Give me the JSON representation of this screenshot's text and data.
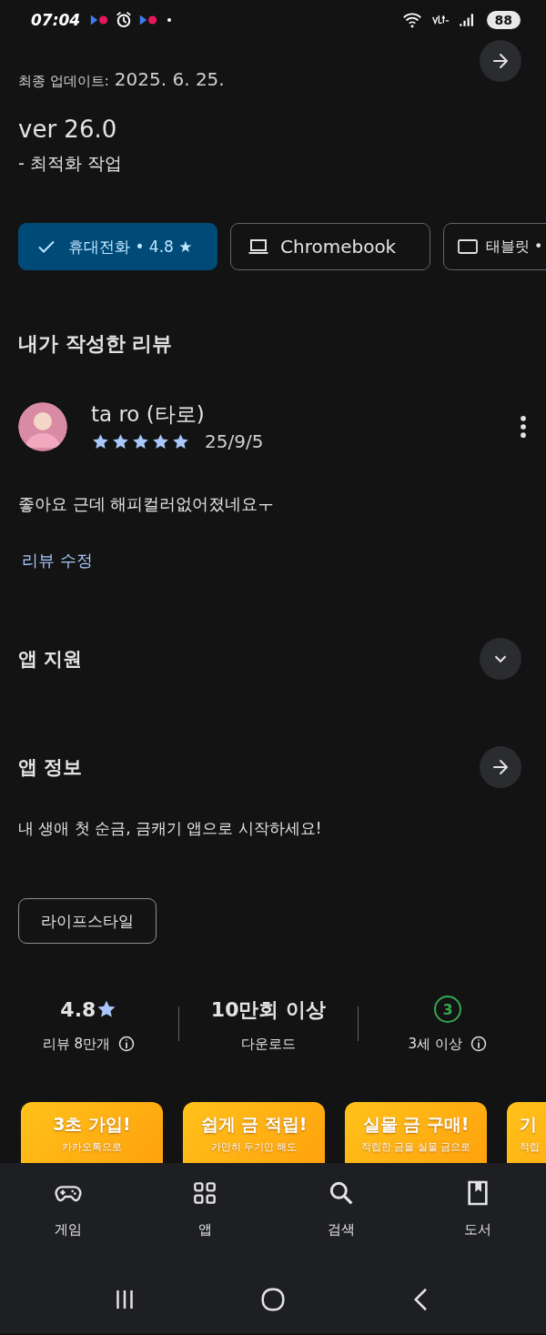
{
  "status_bar": {
    "time": "07:04",
    "battery": "88"
  },
  "update": {
    "last_updated_label": "최종 업데이트:",
    "last_updated": "2025. 6. 25.",
    "version": "ver 26.0",
    "notes": "- 최적화 작업"
  },
  "devices": [
    {
      "kind": "phone",
      "label": "휴대전화 • 4.8 ★",
      "selected": true
    },
    {
      "kind": "laptop",
      "label": "Chromebook",
      "selected": false
    },
    {
      "kind": "tablet",
      "label": "태블릿 •",
      "selected": false
    }
  ],
  "my_review": {
    "heading": "내가 작성한 리뷰",
    "author": "ta ro (타로)",
    "stars": 5,
    "date": "25/9/5",
    "text": "좋아요 근데 해피컬러없어졌네요ㅜ",
    "edit_link": "리뷰 수정"
  },
  "sections": [
    {
      "kind": "expand",
      "title": "앱 지원",
      "expanded": false
    },
    {
      "kind": "link",
      "title": "앱 정보"
    }
  ],
  "description": "내 생애 첫 순금, 금캐기 앱으로 시작하세요!",
  "tags": [
    "라이프스타일"
  ],
  "stats": [
    {
      "kind": "rating",
      "value": "4.8",
      "label": "리뷰 8만개"
    },
    {
      "kind": "plain",
      "value": "10만회 이상",
      "label": "다운로드"
    },
    {
      "kind": "age",
      "value": "3",
      "label": "3세 이상"
    }
  ],
  "screenshots": [
    {
      "title": "3초 가입!",
      "subtitle": "카카오톡으로"
    },
    {
      "title": "쉽게 금 적립!",
      "subtitle": "가만히 두기만 해도"
    },
    {
      "title": "실물 금 구매!",
      "subtitle": "적립한 금을 실물 금으로"
    },
    {
      "title": "기",
      "subtitle": "적립"
    }
  ],
  "bottom_nav": [
    {
      "kind": "games",
      "label": "게임",
      "selected": false
    },
    {
      "kind": "apps",
      "label": "앱",
      "selected": false
    },
    {
      "kind": "search",
      "label": "검색",
      "selected": false
    },
    {
      "kind": "books",
      "label": "도서",
      "selected": false
    }
  ]
}
